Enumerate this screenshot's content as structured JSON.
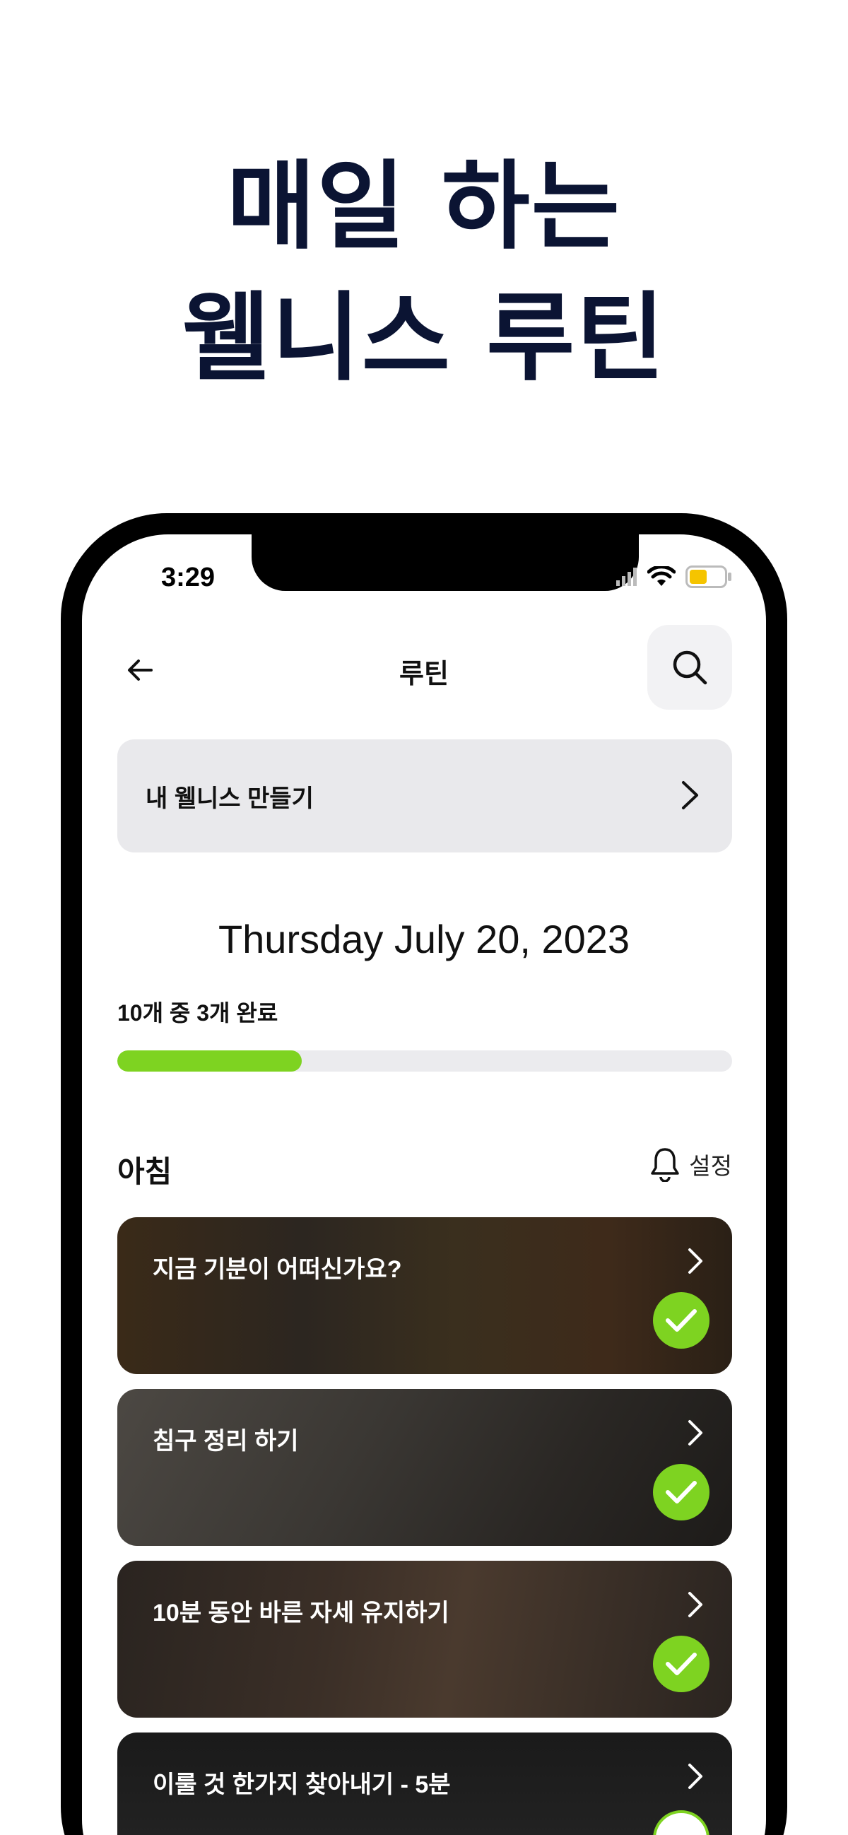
{
  "hero": {
    "line1": "매일 하는",
    "line2": "웰니스 루틴"
  },
  "status_bar": {
    "time": "3:29",
    "icons": [
      "signal-icon",
      "wifi-icon",
      "battery-icon"
    ],
    "battery_color": "#f5c400"
  },
  "nav": {
    "title": "루틴",
    "back_icon": "arrow-left-icon",
    "search_icon": "search-icon"
  },
  "make_wellness": {
    "label": "내 웰니스 만들기",
    "icon": "chevron-right-icon"
  },
  "date": "Thursday July 20, 2023",
  "progress": {
    "text": "10개 중 3개 완료",
    "completed": 3,
    "total": 10,
    "color": "#7ed321"
  },
  "section": {
    "title": "아침",
    "setting_label": "설정",
    "setting_icon": "bell-icon"
  },
  "routines": [
    {
      "title": "지금 기분이 어떠신가요?",
      "completed": true
    },
    {
      "title": "침구 정리 하기",
      "completed": true
    },
    {
      "title": "10분 동안 바른 자세 유지하기",
      "completed": true
    },
    {
      "title": "이룰 것 한가지 찾아내기 - 5분",
      "completed": false
    }
  ],
  "colors": {
    "hero_text": "#0b1433",
    "accent_green": "#7ed321"
  }
}
